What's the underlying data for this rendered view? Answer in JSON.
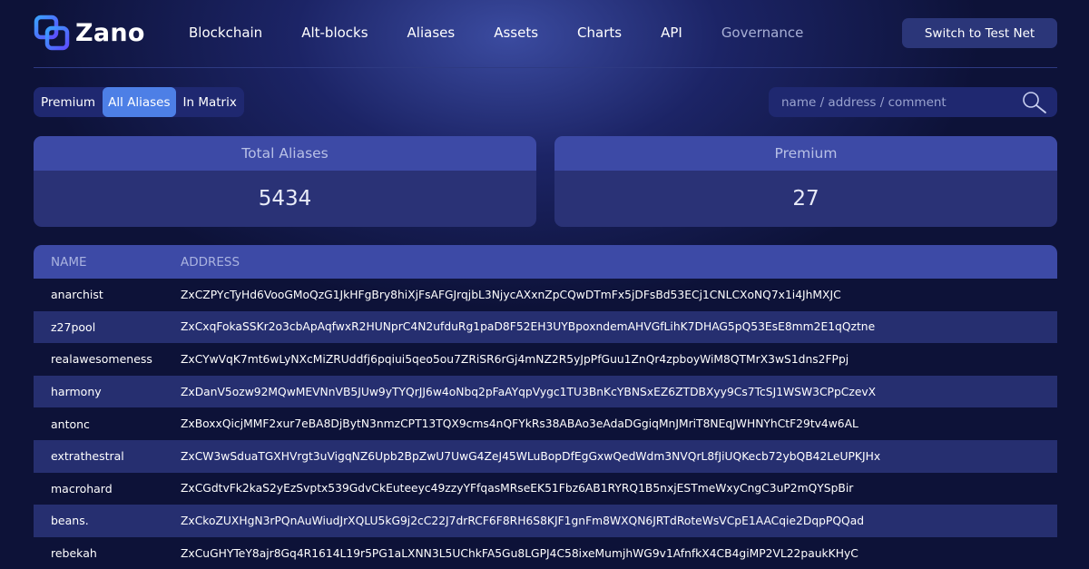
{
  "app": {
    "logo_text": "Zano",
    "brand_colors": {
      "background": "#0d1238",
      "accent": "#4d7fe6",
      "panel": "#2a3276",
      "header": "#3d4aa6"
    }
  },
  "nav": [
    {
      "label": "Blockchain"
    },
    {
      "label": "Alt-blocks"
    },
    {
      "label": "Aliases"
    },
    {
      "label": "Assets"
    },
    {
      "label": "Charts"
    },
    {
      "label": "API"
    },
    {
      "label": "Governance"
    }
  ],
  "header": {
    "testnet_button": "Switch to Test Net"
  },
  "filters": {
    "tabs": [
      {
        "label": "Premium",
        "active": false
      },
      {
        "label": "All Aliases",
        "active": true
      },
      {
        "label": "In Matrix",
        "active": false
      }
    ]
  },
  "search": {
    "placeholder": "name / address / comment",
    "value": "",
    "icon": "search-icon"
  },
  "stats": {
    "total": {
      "label": "Total Aliases",
      "value": "5434"
    },
    "premium": {
      "label": "Premium",
      "value": "27"
    }
  },
  "table": {
    "columns": [
      "NAME",
      "ADDRESS"
    ],
    "rows": [
      {
        "name": "anarchist",
        "address": "ZxCZPYcTyHd6VooGMoQzG1JkHFgBry8hiXjFsAFGJrqjbL3NjycAXxnZpCQwDTmFx5jDFsBd53ECj1CNLCXoNQ7x1i4JhMXJC"
      },
      {
        "name": "z27pool",
        "address": "ZxCxqFokaSSKr2o3cbApAqfwxR2HUNprC4N2ufduRg1paD8F52EH3UYBpoxndemAHVGfLihK7DHAG5pQ53EsE8mm2E1qQztne"
      },
      {
        "name": "realawesomeness",
        "address": "ZxCYwVqK7mt6wLyNXcMiZRUddfj6pqiui5qeo5ou7ZRiSR6rGj4mNZ2R5yJpPfGuu1ZnQr4zpboyWiM8QTMrX3wS1dns2FPpj"
      },
      {
        "name": "harmony",
        "address": "ZxDanV5ozw92MQwMEVNnVB5JUw9yTYQrJJ6w4oNbq2pFaAYqpVygc1TU3BnKcYBNSxEZ6ZTDBXyy9Cs7TcSJ1WSW3CPpCzevX"
      },
      {
        "name": "antonc",
        "address": "ZxBoxxQicjMMF2xur7eBA8DjBytN3nmzCPT13TQX9cms4nQFYkRs38ABAo3eAdaDGgiqMnJMriT8NEqJWHNYhCtF29tv4w6AL"
      },
      {
        "name": "extrathestral",
        "address": "ZxCW3wSduaTGXHVrgt3uVigqNZ6Upb2BpZwU7UwG4ZeJ45WLuBopDfEgGxwQedWdm3NVQrL8fJiUQKecb72ybQB42LeUPKJHx"
      },
      {
        "name": "macrohard",
        "address": "ZxCGdtvFk2kaS2yEzSvptx539GdvCkEuteeyc49zzyYFfqasMRseEK51Fbz6AB1RYRQ1B5nxjESTmeWxyCngC3uP2mQYSpBir"
      },
      {
        "name": "beans.",
        "address": "ZxCkoZUXHgN3rPQnAuWiudJrXQLU5kG9j2cC22J7drRCF6F8RH6S8KJF1gnFm8WXQN6JRTdRoteWsVCpE1AACqie2DqpPQQad"
      },
      {
        "name": "rebekah",
        "address": "ZxCuGHYTeY8ajr8Gq4R1614L19r5PG1aLXNN3L5UChkFA5Gu8LGPJ4C58ixeMumjhWG9v1AfnfkX4CB4giMP2VL22paukKHyC"
      }
    ]
  }
}
